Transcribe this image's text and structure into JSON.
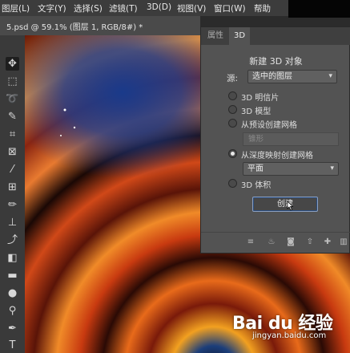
{
  "menubar": {
    "items": [
      "图层(L)",
      "文字(Y)",
      "选择(S)",
      "滤镜(T)",
      "3D(D)",
      "视图(V)",
      "窗口(W)",
      "帮助"
    ]
  },
  "document_tab": {
    "label": "5.psd @ 59.1% (图层 1, RGB/8#) *"
  },
  "tools": [
    "move-icon",
    "marquee-icon",
    "lasso-icon",
    "quick-select-icon",
    "crop-icon",
    "frame-icon",
    "eyedropper-icon",
    "healing-icon",
    "brush-icon",
    "stamp-icon",
    "history-brush-icon",
    "eraser-icon",
    "gradient-icon",
    "blur-icon",
    "dodge-icon",
    "pen-icon",
    "type-icon"
  ],
  "panel": {
    "tabs": [
      "属性",
      "3D"
    ],
    "title": "新建 3D 对象",
    "source_label": "源:",
    "source_value": "选中的图层",
    "options": [
      "3D 明信片",
      "3D 模型",
      "从预设创建网格",
      "从深度映射创建网格",
      "3D 体积"
    ],
    "preset_placeholder": "锥形",
    "depth_map_value": "平面",
    "create_button": "创建",
    "selected_option": "从深度映射创建网格"
  },
  "watermark": {
    "logo": "Bai du 经验",
    "url": "jingyan.baidu.com"
  },
  "colors": {
    "accent": "#8a9fc0",
    "panel_bg": "#535353",
    "toolbar_bg": "#3a3a3a"
  }
}
